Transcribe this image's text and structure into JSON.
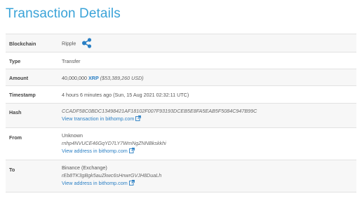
{
  "page": {
    "title": "Transaction Details"
  },
  "rows": {
    "blockchain": {
      "label": "Blockchain",
      "value": "Ripple",
      "icon": "ripple-logo-icon"
    },
    "type": {
      "label": "Type",
      "value": "Transfer"
    },
    "amount": {
      "label": "Amount",
      "value": "40,000,000",
      "currency": "XRP",
      "usd": "($53,389,260 USD)"
    },
    "timestamp": {
      "label": "Timestamp",
      "value": "4 hours 6 minutes ago (Sun, 15 Aug 2021 02:32:11 UTC)"
    },
    "hash": {
      "label": "Hash",
      "value": "CCADF58C0BDC13498421AF18102F007F93193DCEB5E8FA5EAB5F5084C947B99C",
      "link": "View transaction in bithomp.com"
    },
    "from": {
      "label": "From",
      "name": "Unknown",
      "address": "rnhp4NVUCE46GqYD7LY7WmNgZNNBkskkhi",
      "link": "View address in bithomp.com"
    },
    "to": {
      "label": "To",
      "name": "Binance (Exchange)",
      "address": "rEb8TK3gBgk5auZkwc6sHnwrGVJH8DuaLh",
      "link": "View address in bithomp.com"
    }
  },
  "colors": {
    "title": "#3aa3d8",
    "link": "#2a7fc4",
    "row_shade": "#f7f7f7",
    "border": "#e2e2e2"
  }
}
